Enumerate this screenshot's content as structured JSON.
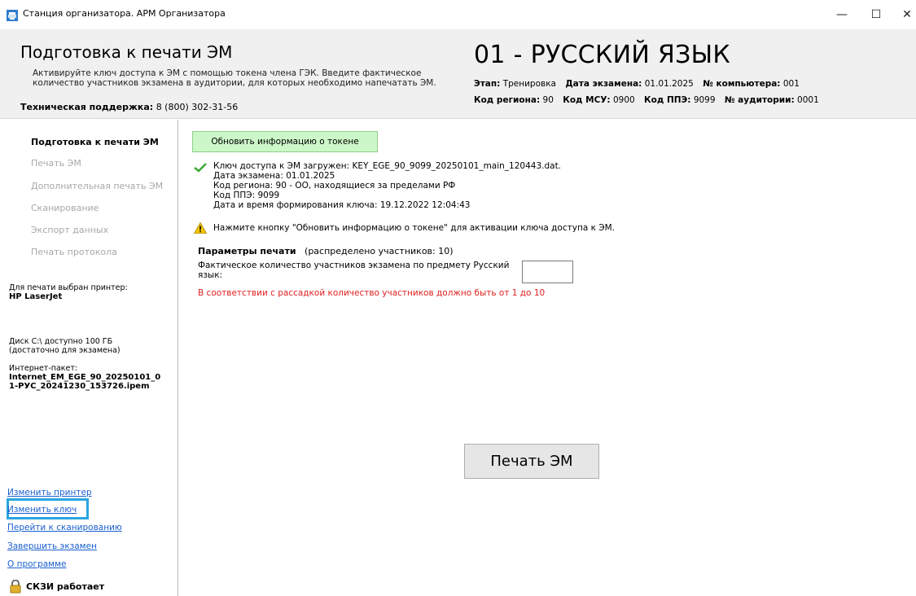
{
  "window": {
    "title": "Станция организатора. АРМ Организатора",
    "min_symbol": "—",
    "max_symbol": "☐",
    "close_symbol": "✕"
  },
  "header": {
    "title": "Подготовка к печати ЭМ",
    "description": "Активируйте ключ доступа к ЭМ с помощью токена члена ГЭК. Введите фактическое количество участников экзамена в аудитории, для которых необходимо напечатать ЭМ.",
    "support_label": "Техническая поддержка:",
    "support_value": "8 (800) 302-31-56",
    "subject": "01 - РУССКИЙ ЯЗЫК",
    "stage_label": "Этап:",
    "stage_value": "Тренировка",
    "exam_date_label": "Дата экзамена:",
    "exam_date_value": "01.01.2025",
    "computer_label": "№ компьютера:",
    "computer_value": "001",
    "region_label": "Код региона:",
    "region_value": "90",
    "msu_label": "Код МСУ:",
    "msu_value": "0900",
    "ppe_label": "Код ППЭ:",
    "ppe_value": "9099",
    "room_label": "№ аудитории:",
    "room_value": "0001"
  },
  "sidebar": {
    "nav": [
      {
        "label": "Подготовка к печати ЭМ",
        "active": true
      },
      {
        "label": "Печать ЭМ",
        "active": false
      },
      {
        "label": "Дополнительная печать ЭМ",
        "active": false
      },
      {
        "label": "Сканирование",
        "active": false
      },
      {
        "label": "Экспорт данных",
        "active": false
      },
      {
        "label": "Печать протокола",
        "active": false
      }
    ],
    "printer_label": "Для печати выбран принтер:",
    "printer_name": "HP LaserJet",
    "disk_line1": "Диск C:\\ доступно 100 ГБ",
    "disk_line2": "(достаточно для экзамена)",
    "package_label": "Интернет-пакет:",
    "package_line1": "Internet_EM_EGE_90_20250101_0",
    "package_line2": "1-РУС_20241230_153726.ipem",
    "links": [
      "Изменить принтер",
      "Изменить ключ",
      "Перейти к сканированию",
      "Завершить экзамен",
      "О программе"
    ],
    "skzi_status": "СКЗИ работает"
  },
  "main": {
    "refresh_button": "Обновить информацию о токене",
    "key_loaded": "Ключ доступа к ЭМ загружен: KEY_EGE_90_9099_20250101_main_120443.dat.",
    "key_exam_date": "Дата экзамена: 01.01.2025",
    "key_region": "Код региона: 90 - ОО, находящиеся за пределами РФ",
    "key_ppe": "Код ППЭ: 9099",
    "key_created": "Дата и время формирования ключа: 19.12.2022 12:04:43",
    "warning": "Нажмите кнопку \"Обновить информацию о токене\" для активации ключа доступа к ЭМ.",
    "params_title": "Параметры печати",
    "params_distributed": "(распределено участников: 10)",
    "count_label": "Фактическое количество участников экзамена по предмету Русский язык:",
    "count_value": "",
    "error": "В соответствии с рассадкой количество участников должно быть от 1 до 10",
    "print_button": "Печать ЭМ"
  },
  "colors": {
    "refresh_bg": "#ccf7c8",
    "error": "#e02020",
    "link": "#1a5fd0",
    "highlight": "#29a6e0",
    "check": "#3aaa35",
    "warning": "#f5c400"
  }
}
